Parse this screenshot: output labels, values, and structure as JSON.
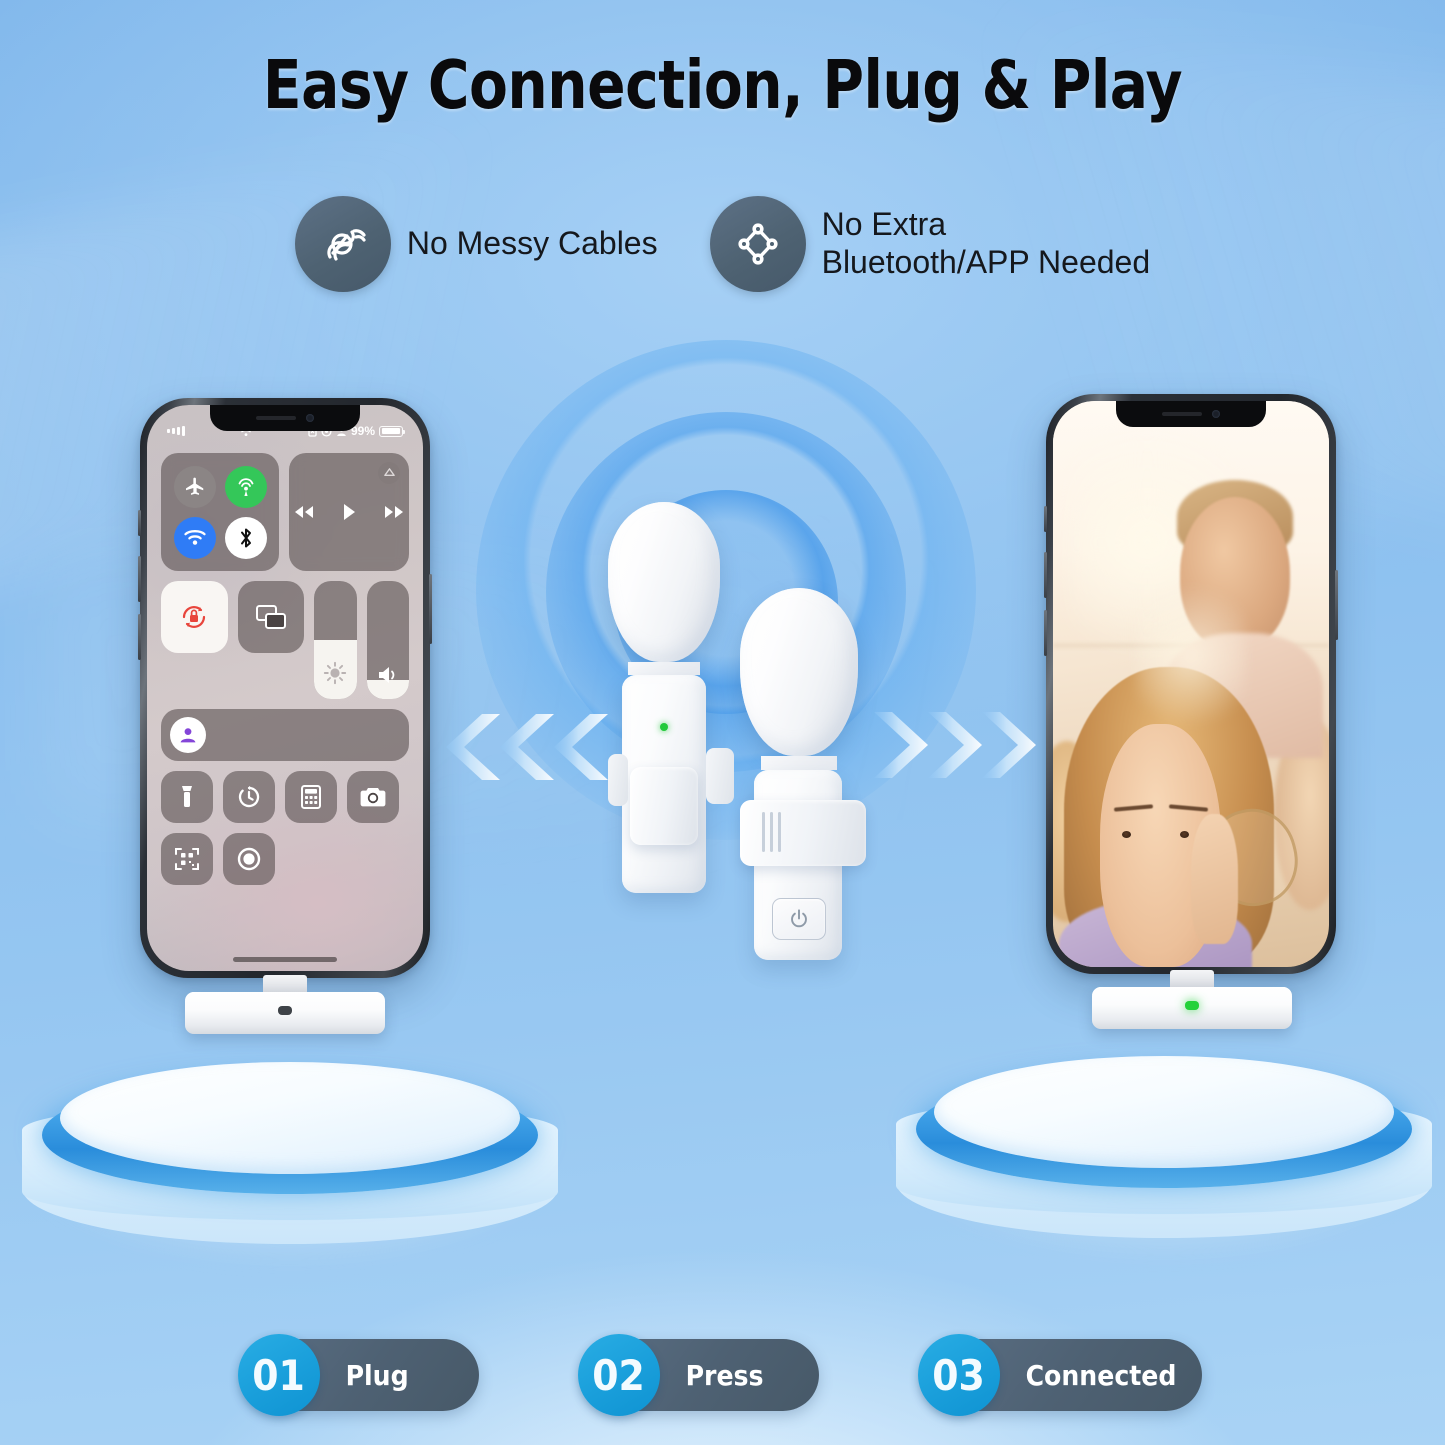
{
  "headline": "Easy Connection, Plug & Play",
  "features": [
    {
      "icon": "tangled-cable-icon",
      "label": "No Messy Cables",
      "label_line2": ""
    },
    {
      "icon": "network-nodes-icon",
      "label": "No Extra",
      "label_line2": "Bluetooth/APP Needed"
    }
  ],
  "steps": [
    {
      "number": "01",
      "label": "Plug"
    },
    {
      "number": "02",
      "label": "Press"
    },
    {
      "number": "03",
      "label": "Connected"
    }
  ],
  "phones": {
    "left": {
      "screen": "ios-control-center",
      "status_bar": {
        "battery_percent": "99%",
        "signal": "signal-bars-icon",
        "wifi": "wifi-icon",
        "battery": "battery-icon"
      },
      "toggles": [
        {
          "name": "airplane-mode",
          "state": "off"
        },
        {
          "name": "cellular-data",
          "state": "on"
        },
        {
          "name": "wifi",
          "state": "on"
        },
        {
          "name": "bluetooth",
          "state": "on"
        }
      ],
      "controls": [
        "media-player",
        "rotation-lock",
        "screen-mirroring",
        "focus-mode",
        "brightness-slider",
        "volume-slider",
        "flashlight",
        "timer",
        "calculator",
        "camera",
        "qr-scanner",
        "screen-recording"
      ]
    },
    "right": {
      "screen": "selfie-photo",
      "description": "Friends taking a sunlit selfie"
    }
  },
  "receivers": [
    {
      "side": "left",
      "led": "off",
      "led_color": "#3e4348"
    },
    {
      "side": "right",
      "led": "on",
      "led_color": "#24d13a"
    }
  ],
  "microphones": [
    {
      "name": "lavalier-mic-front",
      "led": "on",
      "led_color": "#22c93a",
      "has_power_button": false
    },
    {
      "name": "lavalier-mic-back",
      "led": "off",
      "has_power_button": true,
      "power_icon": "power-symbol"
    }
  ],
  "arrows": {
    "left": {
      "direction": "left",
      "count": 3
    },
    "right": {
      "direction": "right",
      "count": 3
    }
  },
  "colors": {
    "background": "#8ebdf0",
    "badge_circle": "#4e6272",
    "pill_body": "#4e6173",
    "pill_number": "#1a9fdb",
    "led_green": "#22c93a",
    "ring_blue": "#3e9fe6",
    "title_text": "#0a0a0c"
  }
}
